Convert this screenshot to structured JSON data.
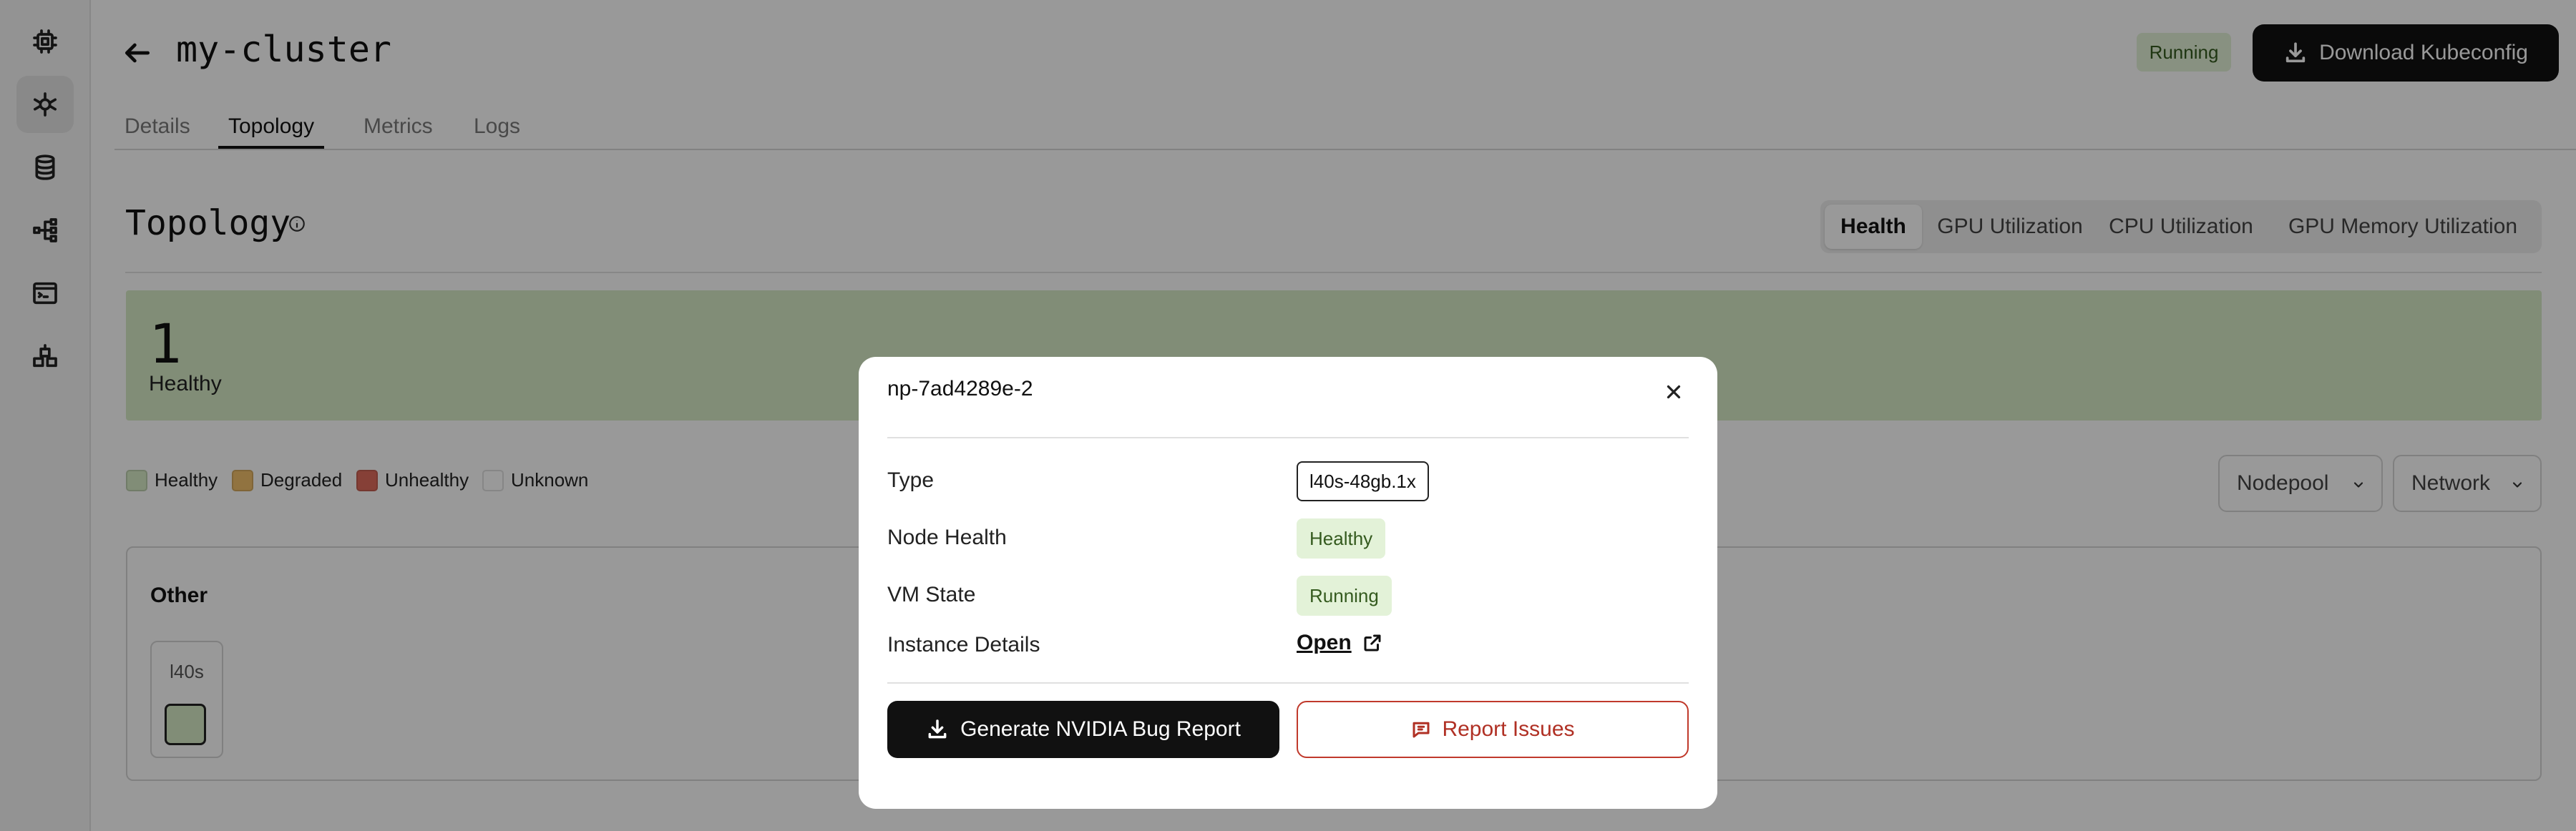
{
  "header": {
    "title": "my-cluster",
    "status": "Running",
    "download_label": "Download Kubeconfig"
  },
  "sidebar": {
    "items": [
      {
        "icon": "chip-icon"
      },
      {
        "icon": "kubernetes-icon",
        "active": true
      },
      {
        "icon": "database-icon"
      },
      {
        "icon": "network-icon"
      },
      {
        "icon": "terminal-window-icon"
      },
      {
        "icon": "stack-icon"
      }
    ]
  },
  "tabs": [
    "Details",
    "Topology",
    "Metrics",
    "Logs"
  ],
  "active_tab": "Topology",
  "topology": {
    "title": "Topology",
    "views": [
      "Health",
      "GPU Utilization",
      "CPU Utilization",
      "GPU Memory Utilization"
    ],
    "active_view": "Health",
    "summary": {
      "count": "1",
      "label": "Healthy"
    },
    "legend": [
      {
        "label": "Healthy",
        "color": "#d8ecc7"
      },
      {
        "label": "Degraded",
        "color": "#f2c06b"
      },
      {
        "label": "Unhealthy",
        "color": "#e06b5c"
      },
      {
        "label": "Unknown",
        "color": "#ffffff"
      }
    ],
    "filters": {
      "nodepool": "Nodepool",
      "network": "Network"
    },
    "group": {
      "title": "Other",
      "node_type": "l40s",
      "node_status": "Healthy"
    }
  },
  "modal": {
    "title": "np-7ad4289e-2",
    "rows": {
      "type_label": "Type",
      "type_value": "l40s-48gb.1x",
      "health_label": "Node Health",
      "health_value": "Healthy",
      "vm_label": "VM State",
      "vm_value": "Running",
      "instance_label": "Instance Details",
      "instance_link": "Open"
    },
    "bug_report_label": "Generate NVIDIA Bug Report",
    "report_issues_label": "Report Issues"
  },
  "colors": {
    "accent": "#111111",
    "healthy": "#d8ecc7",
    "danger": "#c0392b",
    "overlay": "rgba(0,0,0,0.40)"
  }
}
